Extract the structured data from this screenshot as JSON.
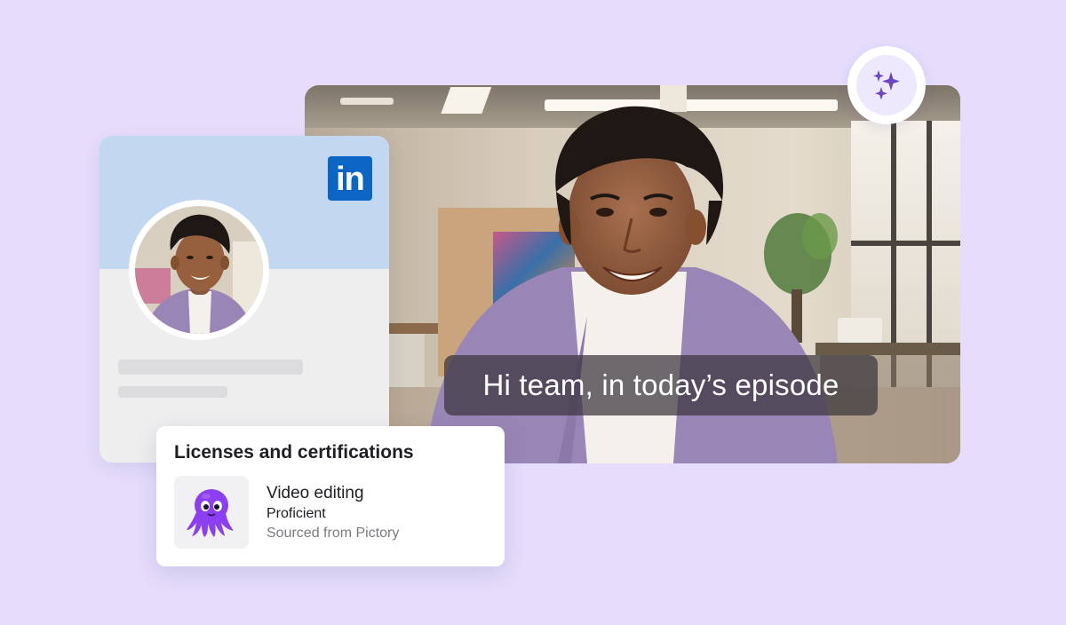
{
  "video": {
    "caption": "Hi team, in today’s episode"
  },
  "profile_card": {
    "brand_logo_text": "in",
    "icons": {
      "brand": "linkedin-icon",
      "avatar": "profile-photo"
    }
  },
  "licenses": {
    "heading": "Licenses and certifications",
    "items": [
      {
        "title": "Video editing",
        "level": "Proficient",
        "source": "Sourced from Pictory",
        "icon": "octopus-icon"
      }
    ]
  },
  "badge": {
    "icon": "sparkles-icon"
  },
  "colors": {
    "background": "#e6ddfc",
    "linkedin_blue": "#0a66c2",
    "cover": "#c2d7f0",
    "octopus": "#8b3ff0",
    "sparkle": "#6a45c4"
  }
}
